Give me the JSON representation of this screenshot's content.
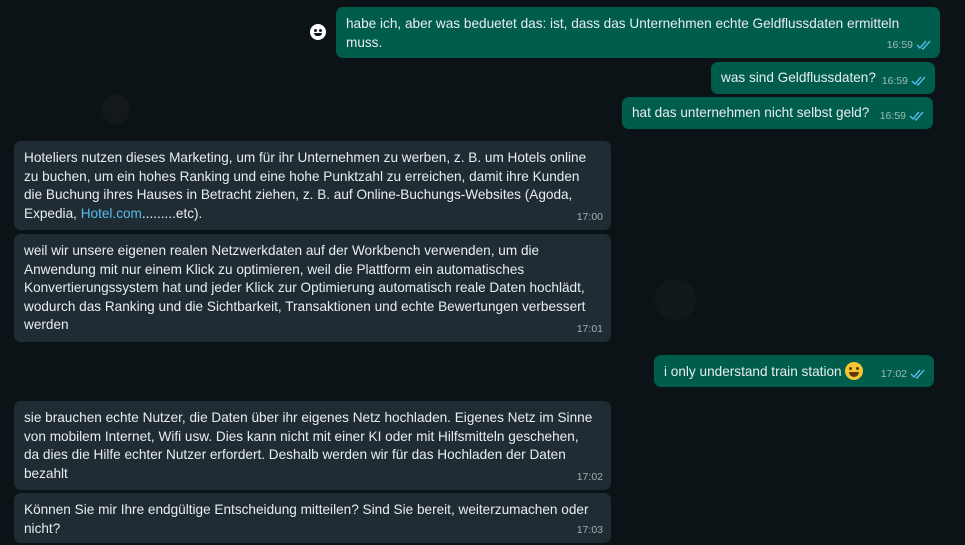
{
  "messages": [
    {
      "direction": "out",
      "text": "habe ich, aber was beduetet das: ist, dass das Unternehmen echte Geldflussdaten ermitteln muss.",
      "time": "16:59"
    },
    {
      "direction": "out",
      "text": "was sind Geldflussdaten?",
      "time": "16:59"
    },
    {
      "direction": "out",
      "text": "hat das unternehmen nicht selbst geld?",
      "time": "16:59"
    },
    {
      "direction": "in",
      "text_before_link": "Hoteliers nutzen dieses Marketing, um für ihr Unternehmen zu werben, z. B. um Hotels online zu buchen, um ein hohes Ranking und eine hohe Punktzahl zu erreichen, damit ihre Kunden die Buchung ihres Hauses in Betracht ziehen, z. B. auf Online-Buchungs-Websites (Agoda, Expedia, ",
      "link": "Hotel.com",
      "text_after_link": ".........etc).",
      "time": "17:00"
    },
    {
      "direction": "in",
      "text": "weil wir unsere eigenen realen Netzwerkdaten auf der Workbench verwenden, um die Anwendung mit nur einem Klick zu optimieren, weil die Plattform ein automatisches Konvertierungssystem hat und jeder Klick zur Optimierung automatisch reale Daten hochlädt, wodurch das Ranking und die Sichtbarkeit, Transaktionen und echte Bewertungen verbessert werden",
      "time": "17:01"
    },
    {
      "direction": "out",
      "text": "i only understand train station",
      "emoji": "grinning-sweat-emoji",
      "time": "17:02"
    },
    {
      "direction": "in",
      "text": "sie brauchen echte Nutzer, die Daten über ihr eigenes Netz hochladen. Eigenes Netz im Sinne von mobilem Internet, Wifi usw. Dies kann nicht mit einer KI oder mit Hilfsmitteln geschehen, da dies die Hilfe echter Nutzer erfordert. Deshalb werden wir für das Hochladen der Daten bezahlt",
      "time": "17:02"
    },
    {
      "direction": "in",
      "text": "Können Sie mir Ihre endgültige Entscheidung mitteilen? Sind Sie bereit, weiterzumachen oder nicht?",
      "time": "17:03"
    }
  ],
  "colors": {
    "background": "#0b141a",
    "outgoing": "#005c4b",
    "incoming": "#202c33",
    "read_tick": "#53bdeb",
    "link": "#53bdeb"
  }
}
